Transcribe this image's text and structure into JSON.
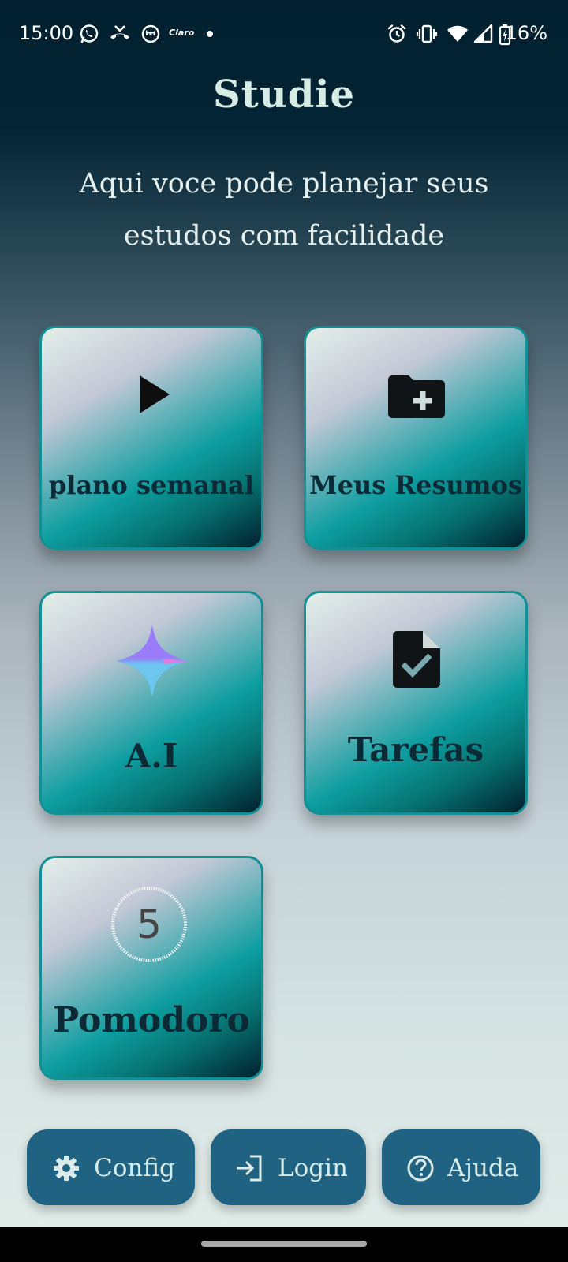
{
  "status_bar": {
    "time": "15:00",
    "carrier": "Claro",
    "battery": "16%",
    "left_icons": [
      "whatsapp-icon",
      "missed-call-icon",
      "cat-app-icon",
      "carrier-logo",
      "notification-dot"
    ],
    "right_icons": [
      "alarm-icon",
      "vibrate-icon",
      "wifi-icon",
      "signal-icon",
      "battery-charging-icon"
    ]
  },
  "header": {
    "title": "Studie",
    "subtitle_line1": "Aqui voce pode planejar seus",
    "subtitle_line2": "estudos com facilidade"
  },
  "cards": [
    {
      "label": "plano semanal",
      "icon": "play-icon"
    },
    {
      "label": "Meus Resumos",
      "icon": "folder-add-icon"
    },
    {
      "label": "A.I",
      "icon": "sparkle-icon"
    },
    {
      "label": "Tarefas",
      "icon": "task-document-icon"
    },
    {
      "label": "Pomodoro",
      "icon": "timer-icon",
      "timer_value": "5"
    }
  ],
  "bottom_nav": {
    "config_label": "Config",
    "login_label": "Login",
    "help_label": "Ajuda"
  },
  "colors": {
    "card_border": "#148f95",
    "button_bg": "#1f6282",
    "title": "#d7ece4",
    "sparkle_purple": "#9b7cf9",
    "sparkle_blue": "#6cc6ef"
  }
}
